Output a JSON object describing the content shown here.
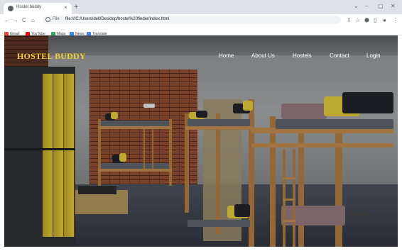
{
  "browser": {
    "tab_title": "Hostel buddy",
    "tab_close": "×",
    "new_tab": "+",
    "window_controls": {
      "minimize": "–",
      "maximize": "▢",
      "close": "✕",
      "collapse": "⌄"
    },
    "nav": {
      "back": "←",
      "forward": "→",
      "reload": "C",
      "home": "⌂"
    },
    "address": {
      "scheme": "File",
      "url": "file:///C:/Users/dell/Desktop/hostel%20finder/index.html"
    },
    "toolbar_icons": {
      "share": "⇪",
      "bookmark": "☆",
      "extensions": "⬢",
      "split": "▯",
      "profile": "●",
      "menu": "⋮"
    },
    "bookmarks": [
      {
        "label": "Gmail",
        "color": "#ea4335"
      },
      {
        "label": "YouTube",
        "color": "#ff0000"
      },
      {
        "label": "Maps",
        "color": "#34a853"
      },
      {
        "label": "News",
        "color": "#4285f4"
      },
      {
        "label": "Translate",
        "color": "#4285f4"
      }
    ]
  },
  "site": {
    "logo": "HOSTEL BUDDY",
    "logo_color": "#f2d230",
    "nav": [
      "Home",
      "About Us",
      "Hostels",
      "Contact",
      "Login"
    ]
  },
  "hero": {
    "description": "hostel dorm room with bunk beds, lockers, brick wall"
  }
}
